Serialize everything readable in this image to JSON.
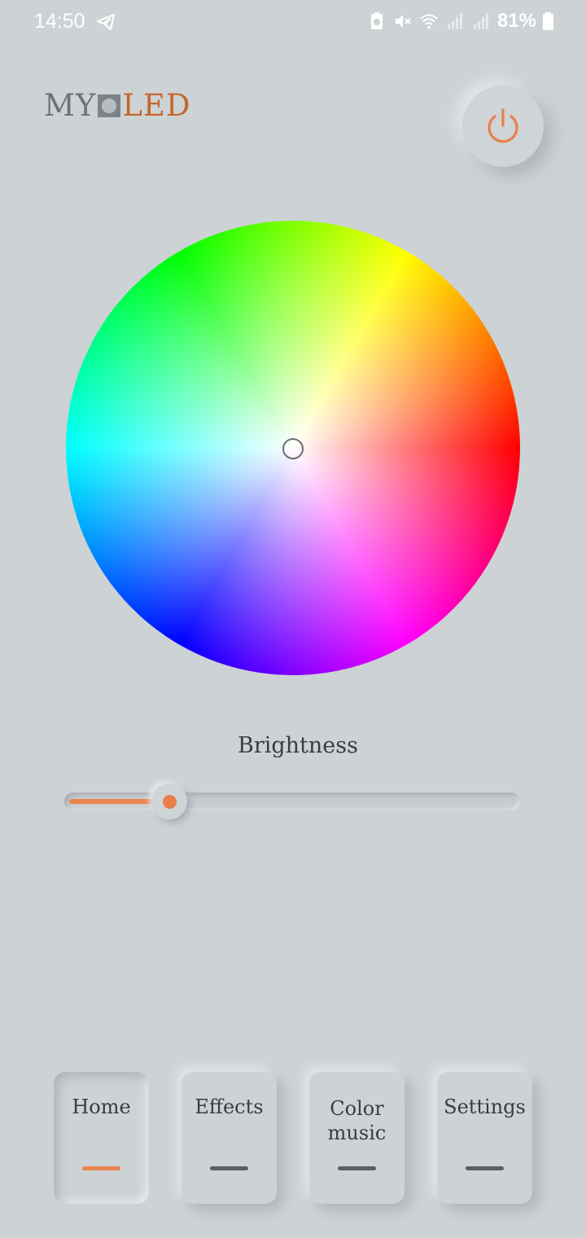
{
  "status_bar": {
    "time": "14:50",
    "battery_percent": "81%",
    "icons": [
      "telegram-icon",
      "battery-saver-icon",
      "mute-icon",
      "wifi-icon",
      "signal-icon",
      "signal-icon",
      "battery-icon"
    ]
  },
  "app": {
    "logo": {
      "part1": "MY",
      "part2": "LED"
    }
  },
  "power_button": {
    "icon": "power-icon",
    "color": "#e8804a"
  },
  "color_wheel": {
    "selected_color": "#ffffff"
  },
  "brightness": {
    "label": "Brightness",
    "value_fraction": 0.22,
    "accent_color": "#ea8550"
  },
  "nav": {
    "tabs": [
      {
        "label": "Home",
        "active": true
      },
      {
        "label": "Effects",
        "active": false
      },
      {
        "label": "Color music",
        "active": false
      },
      {
        "label": "Settings",
        "active": false
      }
    ]
  }
}
